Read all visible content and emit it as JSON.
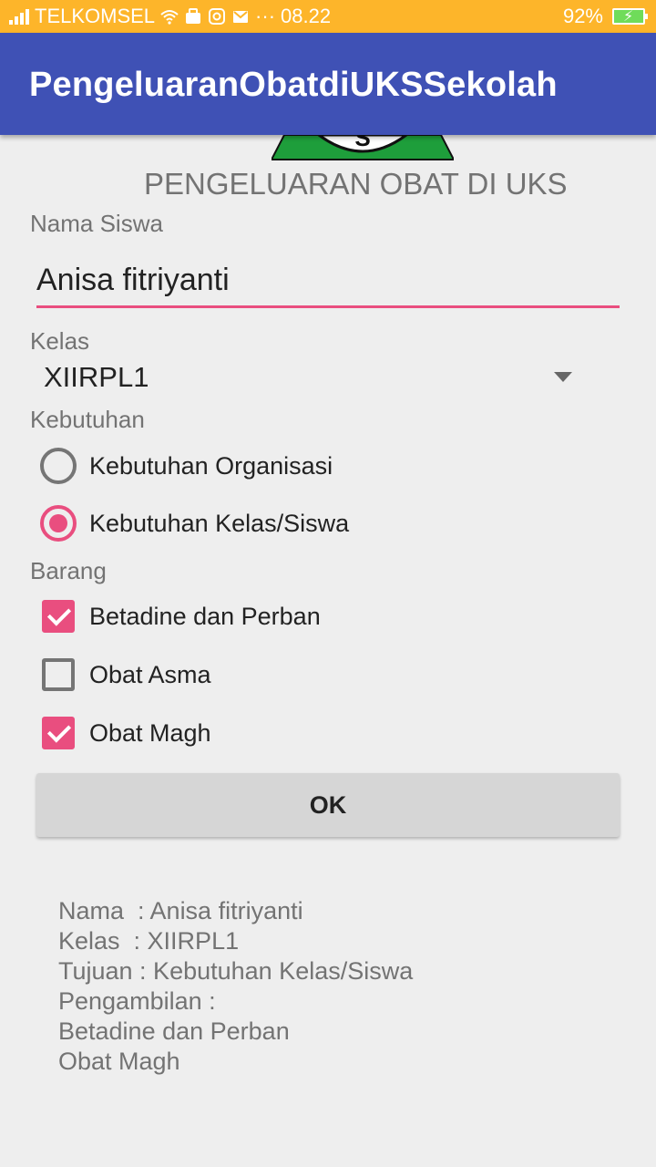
{
  "status_bar": {
    "carrier": "TELKOMSEL",
    "dots": "···",
    "time": "08.22",
    "battery": "92%"
  },
  "app_bar": {
    "title": "PengeluaranObatdiUKSSekolah"
  },
  "logo": {
    "letter": "S"
  },
  "form": {
    "heading": "PENGELUARAN OBAT DI UKS",
    "nama_label": "Nama Siswa",
    "nama_value": "Anisa fitriyanti",
    "kelas_label": "Kelas",
    "kelas_value": "XIIRPL1",
    "kebutuhan_label": "Kebutuhan",
    "kebutuhan_options": [
      {
        "label": "Kebutuhan Organisasi",
        "checked": false
      },
      {
        "label": "Kebutuhan Kelas/Siswa",
        "checked": true
      }
    ],
    "barang_label": "Barang",
    "barang_options": [
      {
        "label": "Betadine dan Perban",
        "checked": true
      },
      {
        "label": "Obat Asma",
        "checked": false
      },
      {
        "label": "Obat Magh",
        "checked": true
      }
    ],
    "ok_label": "OK"
  },
  "result": {
    "lines": [
      "Nama  : Anisa fitriyanti",
      "Kelas  : XIIRPL1",
      "Tujuan : Kebutuhan Kelas/Siswa",
      "Pengambilan :",
      "Betadine dan Perban",
      "Obat Magh"
    ]
  },
  "colors": {
    "accent": "#e94e7f",
    "primary": "#3f51b5",
    "status_bar": "#fdb52a"
  }
}
